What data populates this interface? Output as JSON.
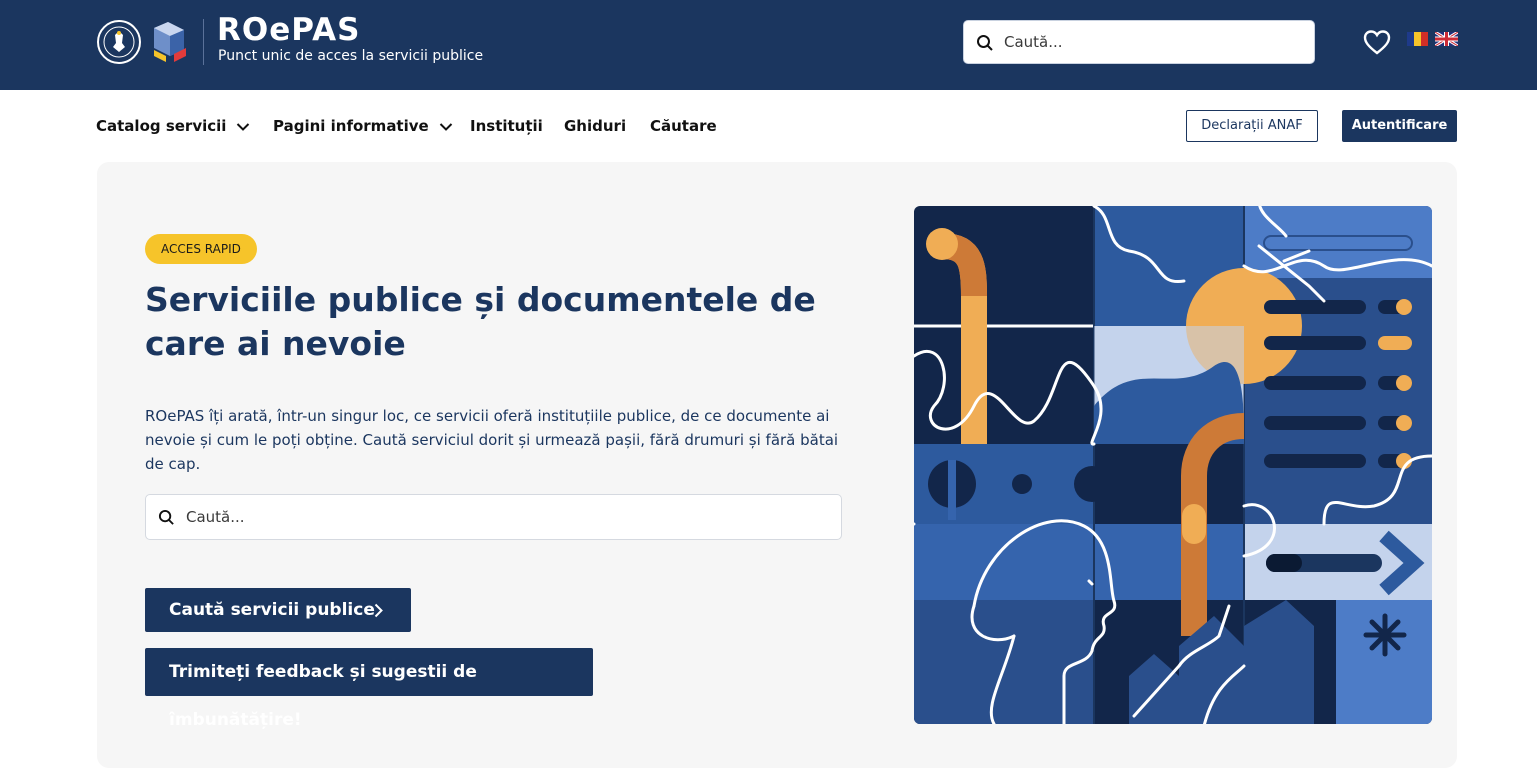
{
  "header": {
    "brand_title": "ROePAS",
    "brand_subtitle": "Punct unic de acces la servicii publice",
    "search_placeholder": "Caută...",
    "languages": [
      "ro",
      "en"
    ]
  },
  "nav": {
    "items": [
      {
        "label": "Catalog servicii",
        "has_dropdown": true
      },
      {
        "label": "Pagini informative",
        "has_dropdown": true
      },
      {
        "label": "Instituții",
        "has_dropdown": false
      },
      {
        "label": "Ghiduri",
        "has_dropdown": false
      },
      {
        "label": "Căutare",
        "has_dropdown": false
      }
    ],
    "anaf_button": "Declarații ANAF",
    "login_button": "Autentificare"
  },
  "hero": {
    "badge": "ACCES RAPID",
    "title": "Serviciile publice și documentele de care ai nevoie",
    "description": "ROePAS îți arată, într-un singur loc, ce servicii oferă instituțiile publice, de ce documente ai nevoie și cum le poți obține. Caută serviciul dorit și urmează pașii, fără drumuri și fără bătai de cap.",
    "search_placeholder": "Caută...",
    "primary_button": "Caută servicii publice",
    "feedback_button": "Trimiteți feedback și sugestii de îmbunătățire!"
  },
  "colors": {
    "brand_navy": "#1b365f",
    "badge_yellow": "#f6c42a",
    "hero_bg": "#f6f6f6",
    "illus_orange": "#f0ad55",
    "illus_blue": "#2d5a9e"
  }
}
